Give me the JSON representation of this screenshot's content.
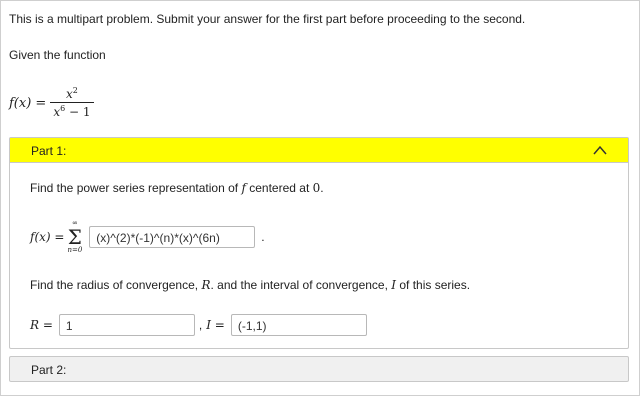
{
  "intro_text": "This is a multipart problem. Submit your answer for the first part before proceeding to the second.",
  "given_text": "Given the function",
  "function": {
    "lhs": "f(x) =",
    "numerator": "x",
    "numerator_exp": "2",
    "denominator": "x",
    "denominator_exp": "6",
    "denominator_tail": " − 1"
  },
  "part1": {
    "label": "Part 1:",
    "question_before": "Find the power series representation of ",
    "question_f": "f",
    "question_middle": " centered at ",
    "question_center": "0",
    "question_end": ".",
    "series_lhs": "f(x) =",
    "sum_upper": "∞",
    "sum_symbol": "Σ",
    "sum_lower": "n=0",
    "series_answer": "(x)^(2)*(-1)^(n)*(x)^(6n)",
    "series_dot": ".",
    "radius_question_1": "Find the radius of convergence, ",
    "radius_symbol": "R",
    "radius_question_2": ". and the interval of convergence, ",
    "interval_symbol": "I",
    "radius_question_3": " of this series.",
    "r_label": "R =",
    "r_value": "1",
    "separator": ",",
    "i_label": "I =",
    "i_value": "(-1,1)"
  },
  "part2": {
    "label": "Part 2:"
  },
  "colors": {
    "part1_header": "#ffff00",
    "part2_header": "#f0f0f0"
  },
  "icons": {
    "collapse": "chevron-up-icon"
  }
}
